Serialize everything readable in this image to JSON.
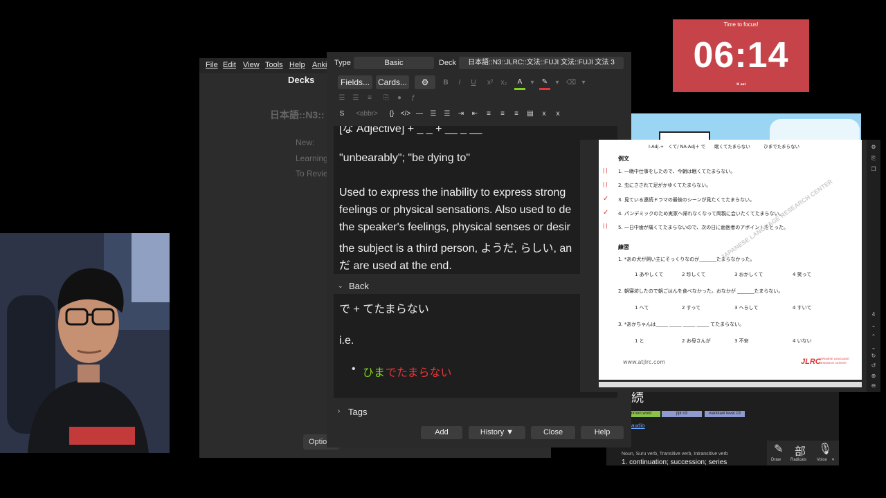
{
  "anki_main": {
    "menu": [
      "File",
      "Edit",
      "View",
      "Tools",
      "Help",
      "Anki"
    ],
    "title": "Decks",
    "deck_name": "日本語::N3::",
    "stats": [
      "New:",
      "Learning",
      "To Revie"
    ],
    "options_label": "Optio"
  },
  "add_window": {
    "type_label": "Type",
    "type_value": "Basic",
    "deck_label": "Deck",
    "deck_value": "日本語::N3::JLRC::文法::FUJI 文法::FUJI 文法 3",
    "fields_btn": "Fields...",
    "cards_btn": "Cards...",
    "gear_icon": "gear-icon",
    "format_row1": [
      "B",
      "I",
      "U",
      "x²",
      "x₂",
      "A",
      "✎",
      "⌫"
    ],
    "format_row3": [
      "<abbr>",
      "{}",
      "</>"
    ],
    "front": {
      "partial_line": "[な Adjective] + _ _ + __ _ __",
      "quote": "\"unbearably\"; \"be dying to\"",
      "desc_lines": [
        "Used to express the inability to express strong",
        "feelings or physical sensations. Also used to de",
        "the speaker's feelings, physical senses or desir",
        "the subject is a third person, ようだ, らしい, an",
        "だ are used at the end."
      ]
    },
    "back_label": "Back",
    "back": {
      "line1": "で + てたまらない",
      "line2": "i.e.",
      "bullet_green": "ひま",
      "bullet_red": "でたまらない"
    },
    "tags_label": "Tags",
    "buttons": {
      "add": "Add",
      "history": "History ▼",
      "close": "Close",
      "help": "Help"
    },
    "colors": {
      "green": "#7ed321",
      "red": "#e8353a"
    }
  },
  "pdf": {
    "header": "I-Adj.+　くて/ NA-Adj＋ で　　眠くてたまらない　　　ひまでたまらない",
    "section1": "例文",
    "examples": [
      "1. 一晩中仕事をしたので、今朝は眠くてたまらない。",
      "2. 虫にさされて足がかゆくてたまらない。",
      "3. 見ている連続ドラマの最後のシーンが見たくてたまらない。",
      "4. パンデミックのため実家へ帰れなくなって両親に会いたくてたまらない。",
      "5. 一日中歯が痛くてたまらないので、次の日に歯医者のアポイントをとった。"
    ],
    "section2": "練習",
    "q1": "1. *あの犬が飼い主にそっくりなのが_______たまらなかった。",
    "q1_opts": [
      "1 あやしくて",
      "2 珍しくて",
      "3 おかしくて",
      "4 笑って"
    ],
    "q2": "2. 朝寝坊したので朝ごはんを食べなかった。おなかが _______たまらない。",
    "q2_opts": [
      "1 へて",
      "2 すって",
      "3 へらして",
      "4 すいて"
    ],
    "q3": "3. *あかちゃんは_____ _____ _____ _____ てたまらない。",
    "q3_opts": [
      "1 と",
      "2 お母さんが",
      "3 不安",
      "4 いない"
    ],
    "footer_url": "www.atjlrc.com",
    "footer_logo": "JLRC",
    "footer_logo_sub1": "JAPANESE LANGUAGE",
    "footer_logo_sub2": "RESEARCH CENTER",
    "watermark": "JAPANESE LANGUAGE RESEARCH CENTER"
  },
  "jisho": {
    "kanji": "続",
    "tags": [
      "mmon word",
      "jlpt n3",
      "wanikani level 19"
    ],
    "audio": "audio",
    "pos": "Noun, Suru verb, Transitive verb, Intransitive verb",
    "meaning": "1. continuation; succession; series",
    "tools": [
      "Draw",
      "Radicals",
      "Voice"
    ]
  },
  "timer": {
    "caption": "Time to focus!",
    "value": "06:14",
    "controls": "⏸ ⏭"
  }
}
